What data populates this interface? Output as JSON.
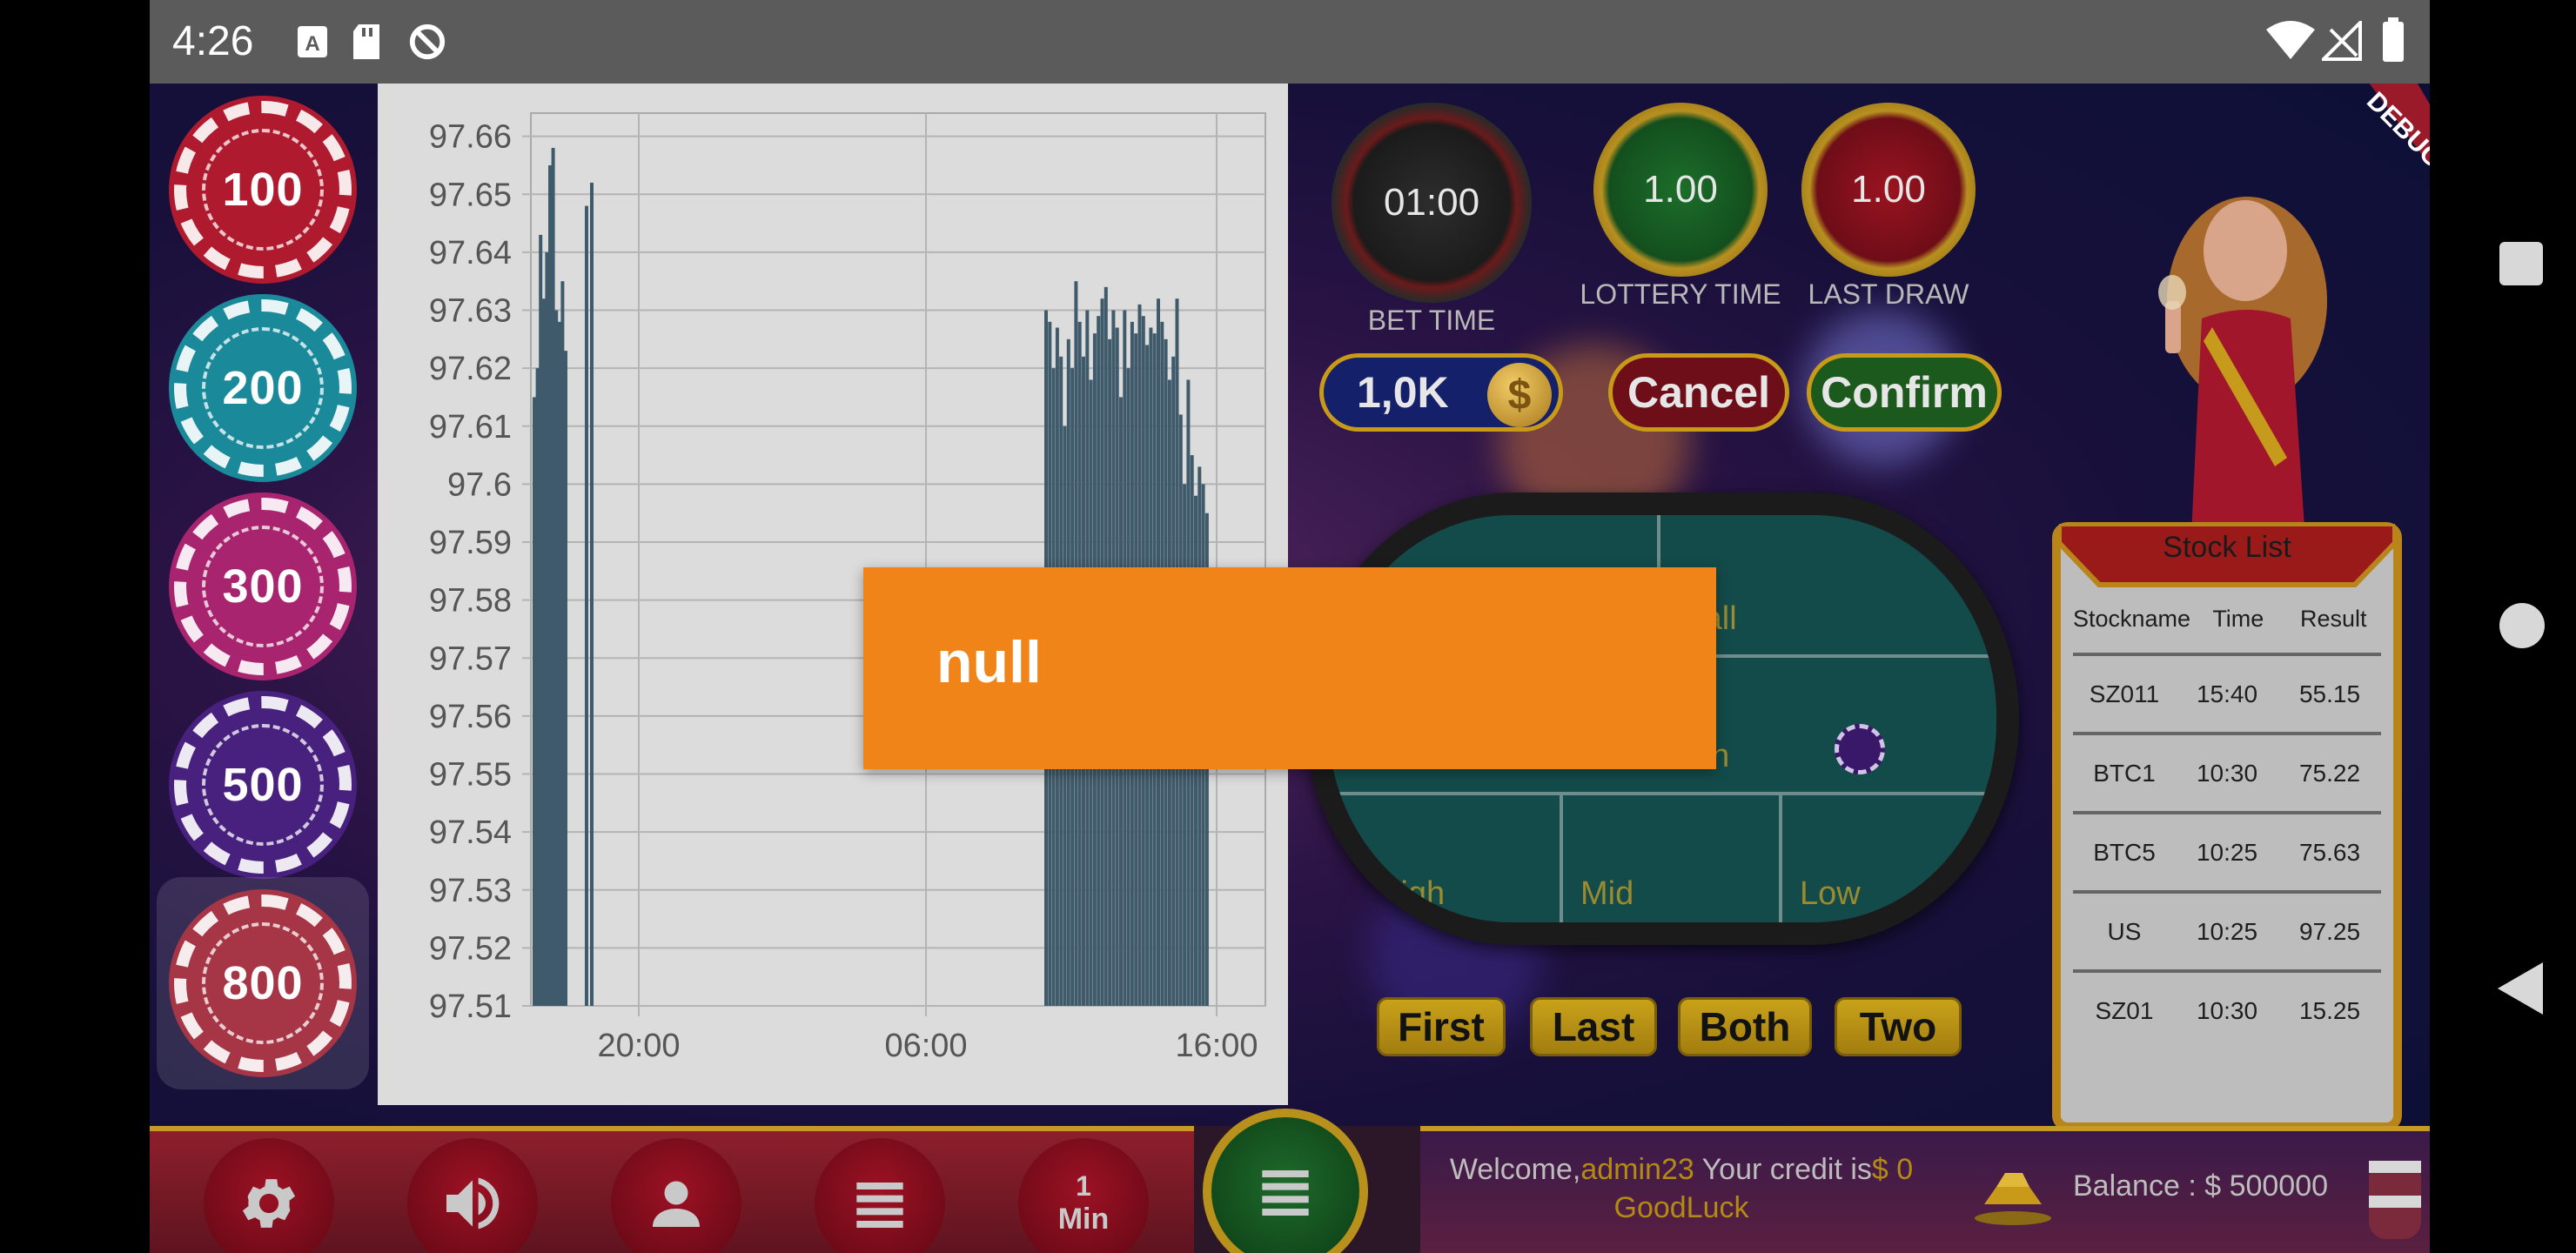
{
  "status_bar": {
    "time": "4:26",
    "icons": [
      "sim-a-icon",
      "sd-card-icon",
      "data-saver-icon",
      "wifi-icon",
      "signal-icon",
      "battery-icon"
    ]
  },
  "debug_banner": "DEBUG",
  "chips": [
    {
      "value": "100",
      "color": "#b01a2f"
    },
    {
      "value": "200",
      "color": "#1a8a9a"
    },
    {
      "value": "300",
      "color": "#a8246e"
    },
    {
      "value": "500",
      "color": "#48207e"
    },
    {
      "value": "800",
      "color": "#9a1a2c",
      "selected": true
    }
  ],
  "chart_data": {
    "type": "bar",
    "ylim": [
      97.51,
      97.66
    ],
    "yticks": [
      "97.66",
      "97.65",
      "97.64",
      "97.63",
      "97.62",
      "97.61",
      "97.6",
      "97.59",
      "97.58",
      "97.57",
      "97.56",
      "97.55",
      "97.54",
      "97.53",
      "97.52",
      "97.51"
    ],
    "xticks": [
      "20:00",
      "06:00",
      "16:00"
    ],
    "series": [
      {
        "values": [
          97.615,
          97.62,
          97.643,
          97.632,
          97.64,
          97.655,
          97.658,
          97.63,
          97.628,
          97.635,
          97.623
        ]
      },
      {
        "values": [
          97.648,
          97.652
        ]
      },
      {
        "values": [
          97.63,
          97.628,
          97.62,
          97.627,
          97.622,
          97.61,
          97.625,
          97.62,
          97.635,
          97.628,
          97.622,
          97.63,
          97.618,
          97.626,
          97.629,
          97.632,
          97.634,
          97.625,
          97.63,
          97.627,
          97.615,
          97.63,
          97.62,
          97.628,
          97.626,
          97.631,
          97.629,
          97.624,
          97.627,
          97.626,
          97.632,
          97.628,
          97.625,
          97.618,
          97.622,
          97.632,
          97.612,
          97.6,
          97.618,
          97.605,
          97.598,
          97.603,
          97.6,
          97.595
        ]
      }
    ]
  },
  "toast": {
    "text": "null"
  },
  "timers": [
    {
      "value": "01:00",
      "caption": "BET TIME"
    },
    {
      "value": "1.00",
      "caption": "LOTTERY TIME"
    },
    {
      "value": "1.00",
      "caption": "LAST DRAW"
    }
  ],
  "bet_amount": "1,0K",
  "coin_symbol": "$",
  "actions": {
    "cancel": "Cancel",
    "confirm": "Confirm"
  },
  "table_areas": {
    "small": "mall",
    "even": "ven",
    "high": "High",
    "mid": "Mid",
    "low": "Low"
  },
  "bet_buttons": [
    "First",
    "Last",
    "Both",
    "Two"
  ],
  "stock_list": {
    "title": "Stock List",
    "columns": [
      "Stockname",
      "Time",
      "Result"
    ],
    "rows": [
      {
        "name": "SZ011",
        "time": "15:40",
        "result": "55.15"
      },
      {
        "name": "BTC1",
        "time": "10:30",
        "result": "75.22"
      },
      {
        "name": "BTC5",
        "time": "10:25",
        "result": "75.63"
      },
      {
        "name": "US",
        "time": "10:25",
        "result": "97.25"
      },
      {
        "name": "SZ01",
        "time": "10:30",
        "result": "15.25"
      }
    ]
  },
  "bottom_bar": {
    "one_min_top": "1",
    "one_min_bottom": "Min",
    "welcome_prefix": "Welcome,",
    "username": "admin23",
    "credit_label": " Your credit is",
    "credit_value": "$ 0",
    "goodluck": "GoodLuck",
    "balance": "Balance : $ 500000"
  }
}
